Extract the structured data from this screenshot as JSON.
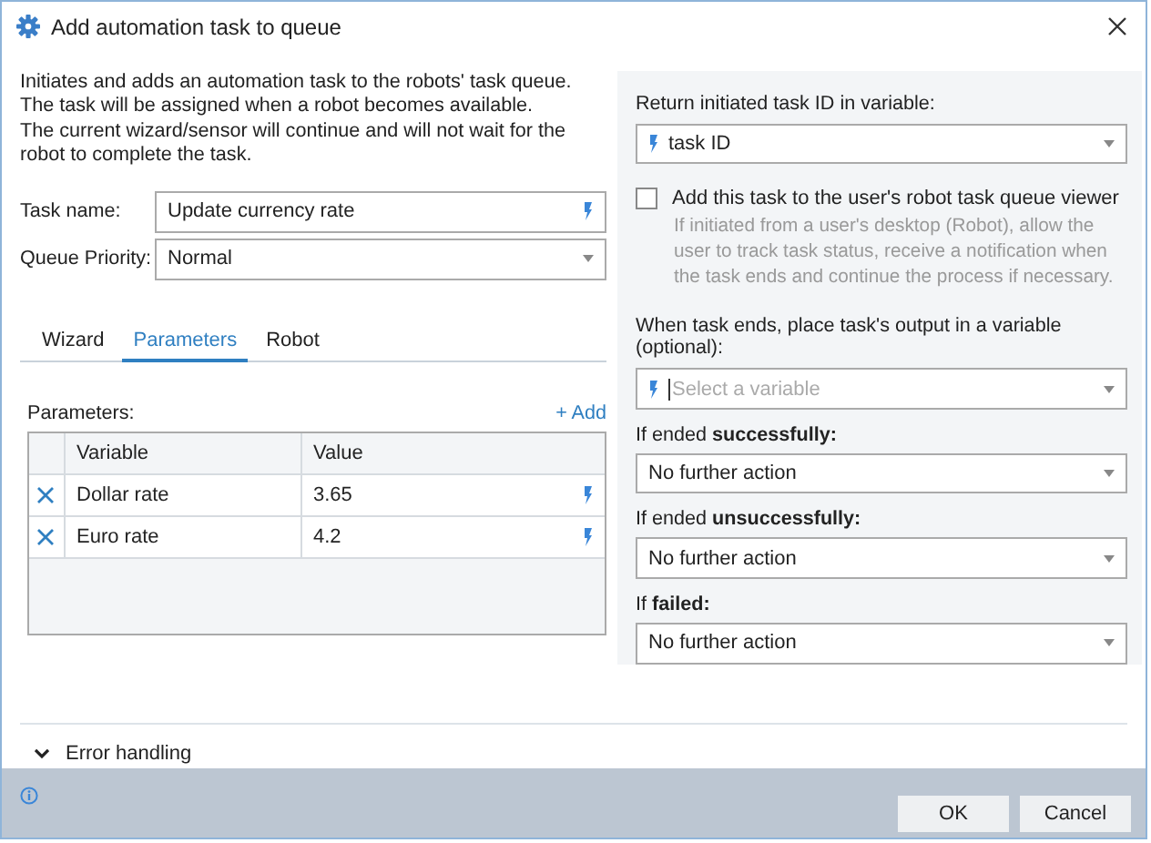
{
  "window": {
    "title": "Add automation task to queue"
  },
  "description": [
    "Initiates and adds an automation task to the robots' task queue. The task will be assigned when a robot becomes available.",
    "The current wizard/sensor will continue and will not wait for the robot to complete the task."
  ],
  "task_name": {
    "label": "Task name:",
    "value": "Update currency rate"
  },
  "queue_priority": {
    "label": "Queue Priority:",
    "value": "Normal"
  },
  "tabs": [
    {
      "label": "Wizard",
      "selected": false
    },
    {
      "label": "Parameters",
      "selected": true
    },
    {
      "label": "Robot",
      "selected": false
    }
  ],
  "parameters": {
    "label": "Parameters:",
    "add": "+ Add",
    "columns": [
      "Variable",
      "Value"
    ],
    "rows": [
      {
        "variable": "Dollar rate",
        "value": "3.65"
      },
      {
        "variable": "Euro rate",
        "value": "4.2"
      }
    ]
  },
  "return_id": {
    "label": "Return initiated task ID in variable:",
    "value": "task ID"
  },
  "queue_viewer": {
    "label": "Add this task to the user's robot task queue viewer",
    "checked": false,
    "hint": "If initiated from a user's desktop (Robot), allow the user to track task status, receive a notification when the task ends and continue the process if necessary."
  },
  "output": {
    "label": "When task ends, place task's output in a variable (optional):",
    "placeholder": "Select a variable"
  },
  "outcomes": [
    {
      "label": "If ended **successfully:**",
      "value": "No further action"
    },
    {
      "label": "If ended **unsuccessfully:**",
      "value": "No further action"
    },
    {
      "label": "If **failed:**",
      "value": "No further action"
    }
  ],
  "error_handling": {
    "label": "Error handling",
    "expanded": false
  },
  "buttons": [
    "OK",
    "Cancel"
  ]
}
